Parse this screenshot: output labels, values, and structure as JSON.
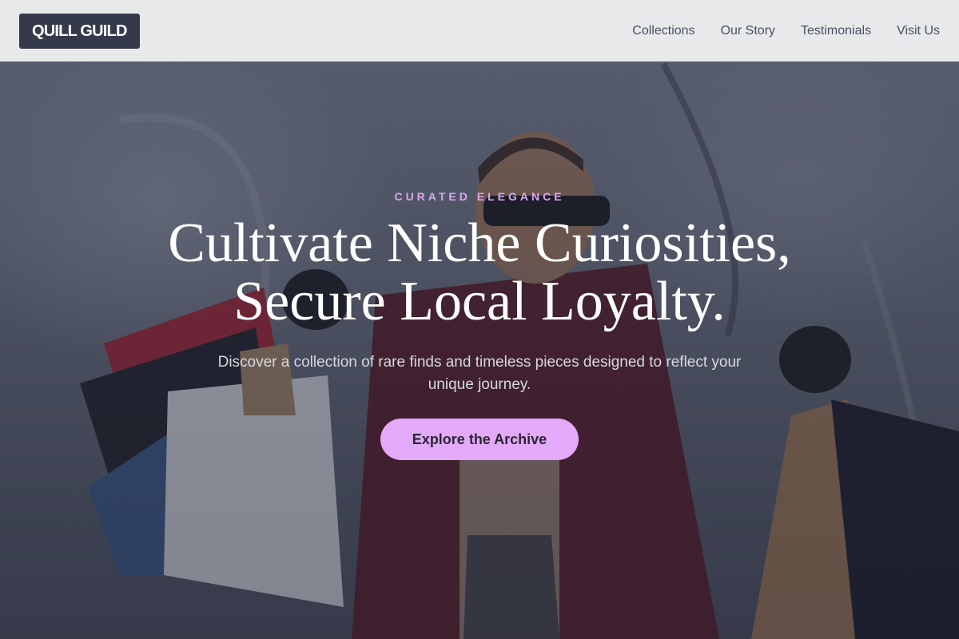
{
  "nav": {
    "logo": "QUILL GUILD",
    "links": [
      "Collections",
      "Our Story",
      "Testimonials",
      "Visit Us"
    ]
  },
  "hero": {
    "eyebrow": "CURATED ELEGANCE",
    "headline_line1": "Cultivate Niche Curiosities,",
    "headline_line2": "Secure Local Loyalty.",
    "subtext": "Discover a collection of rare finds and timeless pieces designed to reflect your unique journey.",
    "cta_label": "Explore the Archive",
    "background_image": "woman-with-shopping-bags-photo"
  },
  "colors": {
    "accent": "#e2aaf8",
    "eyebrow": "#dca6f2",
    "logo_bg": "#353a4b",
    "navbar_bg": "#ecedef"
  }
}
